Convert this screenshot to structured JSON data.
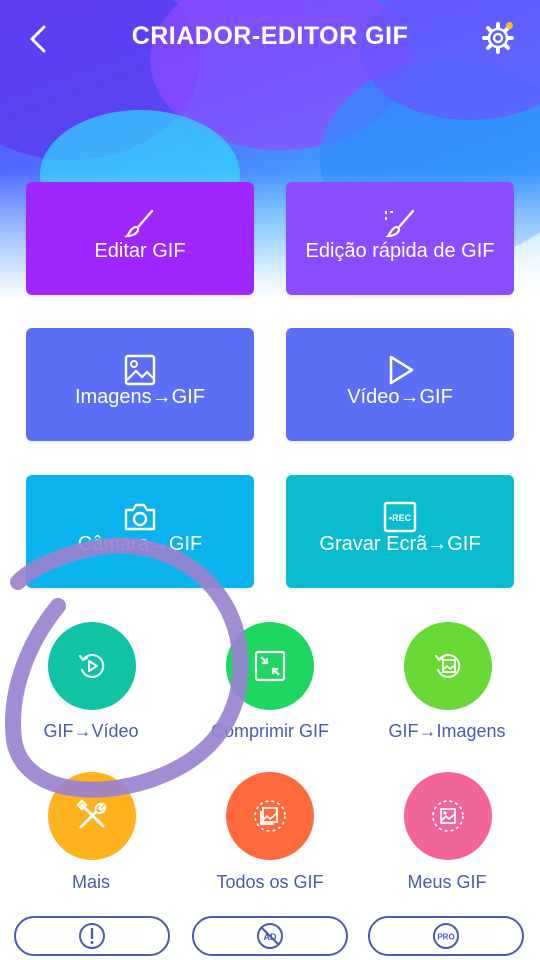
{
  "header": {
    "title": "CRIADOR-EDITOR GIF"
  },
  "cards": {
    "edit_gif": "Editar GIF",
    "quick_edit": "Edição rápida de GIF",
    "images_to_gif": "Imagens→GIF",
    "video_to_gif": "Vídeo→GIF",
    "camera_to_gif": "Câmara→GIF",
    "record_screen": "Gravar Ecrã→GIF",
    "rec_badge": "•REC"
  },
  "tools": {
    "gif_to_video": "GIF→Vídeo",
    "compress_gif": "Comprimir GIF",
    "gif_to_images": "GIF→Imagens",
    "more": "Mais",
    "all_gifs": "Todos os GIF",
    "my_gifs": "Meus GIF"
  },
  "bottom": {
    "ad_badge": "AD",
    "pro_badge": "PRO"
  },
  "colors": {
    "purple": "#a026ff",
    "violet": "#8a4dff",
    "blue": "#5b6ff6",
    "sky": "#0bb3ee",
    "teal": "#09bcd0",
    "green_teal": "#10c3a2",
    "green": "#1ed760",
    "lime": "#67d834",
    "orange": "#ffb21e",
    "red_orange": "#ff6a3d",
    "pink": "#f0659a",
    "label_blue": "#4a5bb0",
    "annotation_purple": "#9a82d0"
  },
  "icons": [
    "back-arrow-icon",
    "settings-gear-icon",
    "brush-icon",
    "quick-brush-icon",
    "image-icon",
    "play-icon",
    "camera-icon",
    "rec-icon",
    "replay-play-icon",
    "compress-icon",
    "replay-image-icon",
    "tools-icon",
    "gallery-icon",
    "image-frame-icon",
    "info-icon",
    "no-ads-icon",
    "pro-icon"
  ]
}
